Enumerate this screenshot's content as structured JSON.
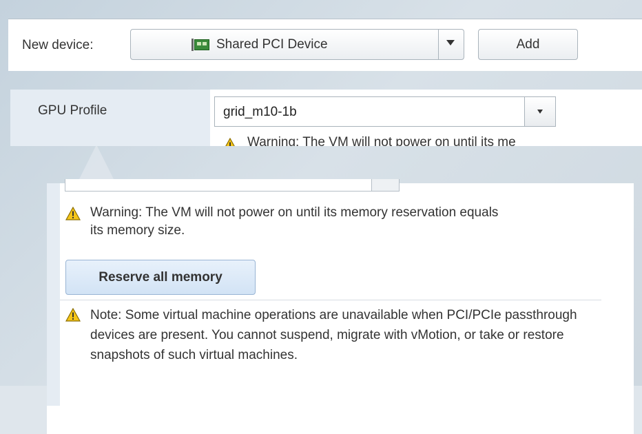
{
  "new_device": {
    "label": "New device:",
    "selected_device": "Shared PCI Device",
    "device_icon": "pci-card-icon",
    "add_label": "Add"
  },
  "gpu_profile": {
    "label": "GPU Profile",
    "value": "grid_m10-1b",
    "warning_peek": "Warning: The VM will not power on until its me"
  },
  "warnings": {
    "memory_warning": "Warning: The VM will not power on until its memory reservation equals its memory size.",
    "reserve_button": "Reserve all memory",
    "passthrough_note": "Note: Some virtual machine operations are unavailable when PCI/PCIe passthrough devices are present. You cannot suspend, migrate with vMotion, or take or restore snapshots of such virtual machines.",
    "warning_icon": "warning-triangle-icon"
  },
  "colors": {
    "warning_yellow": "#f5c518",
    "label_column_bg": "#e5ecf3",
    "primary_button_bg": "#d2e3f5"
  }
}
